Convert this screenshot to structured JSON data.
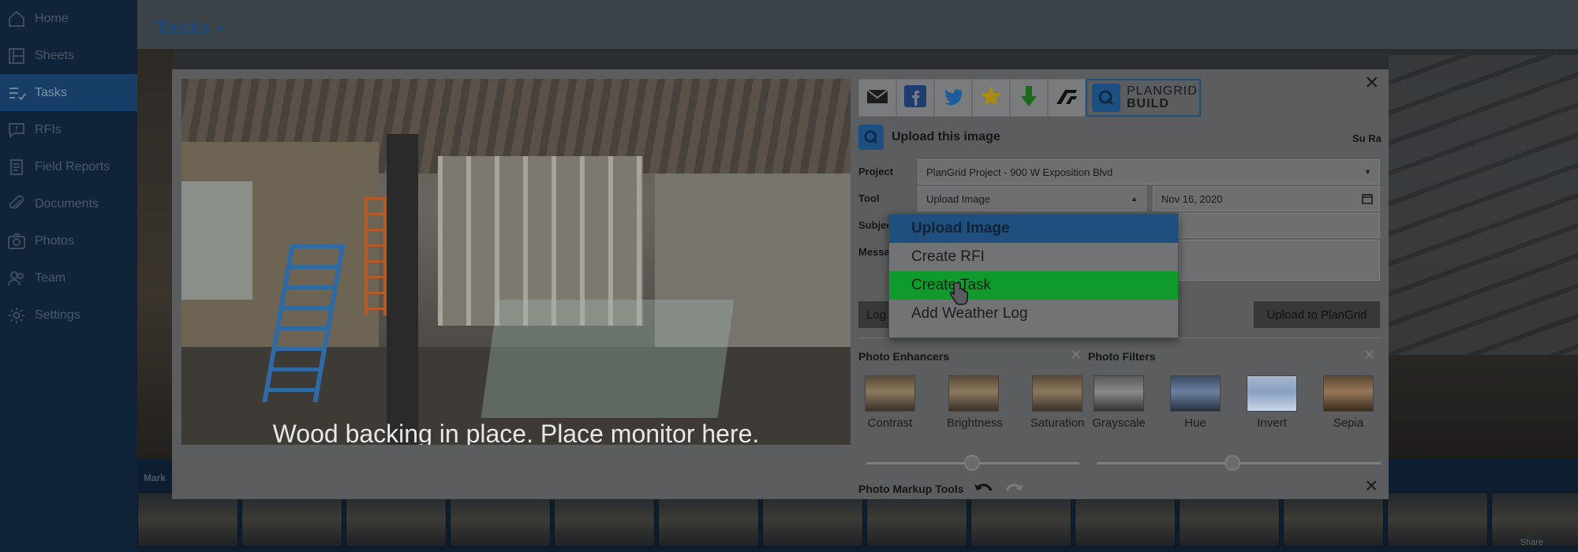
{
  "sidebar": {
    "items": [
      {
        "label": "Home",
        "icon": "home-icon"
      },
      {
        "label": "Sheets",
        "icon": "sheets-icon"
      },
      {
        "label": "Tasks",
        "icon": "tasks-icon",
        "active": true
      },
      {
        "label": "RFIs",
        "icon": "rfi-icon"
      },
      {
        "label": "Field Reports",
        "icon": "field-reports-icon"
      },
      {
        "label": "Documents",
        "icon": "paperclip-icon"
      },
      {
        "label": "Photos",
        "icon": "camera-icon"
      },
      {
        "label": "Team",
        "icon": "team-icon"
      },
      {
        "label": "Settings",
        "icon": "gear-icon"
      }
    ]
  },
  "header": {
    "title": "Tasks"
  },
  "background": {
    "markers_label": "Mark",
    "share_label": "Share"
  },
  "photo": {
    "caption": "Wood backing in place. Place monitor here."
  },
  "share": {
    "buttons": [
      "email-icon",
      "facebook-icon",
      "twitter-icon",
      "star-icon",
      "download-icon",
      "autodesk-icon"
    ],
    "plangrid_line1": "PLANGRID",
    "plangrid_line2": "BUILD"
  },
  "upload": {
    "title": "Upload this image",
    "user_initials": "Su Ra",
    "project_label": "Project",
    "project_value": "PlanGrid Project - 900 W Exposition Blvd",
    "tool_label": "Tool",
    "tool_value": "Upload Image",
    "date_value": "Nov 16, 2020",
    "subject_label": "Subjec",
    "message_label": "Messa",
    "log_button": "Log",
    "upload_button": "Upload to PlanGrid"
  },
  "dropdown": {
    "options": [
      "Upload Image",
      "Create RFI",
      "Create Task",
      "Add Weather Log"
    ],
    "selected": "Upload Image",
    "hovered": "Create Task"
  },
  "enhancers": {
    "title": "Photo Enhancers",
    "items": [
      "Contrast",
      "Brightness",
      "Saturation"
    ]
  },
  "filters": {
    "title": "Photo Filters",
    "items": [
      "Grayscale",
      "Hue",
      "Invert",
      "Sepia"
    ]
  },
  "markup": {
    "title": "Photo Markup Tools"
  },
  "colors": {
    "accent_blue": "#1f4f7f",
    "highlight_green": "#0f9a2e",
    "sidebar_bg": "#102338"
  }
}
